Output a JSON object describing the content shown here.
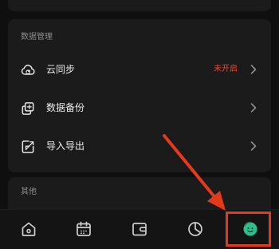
{
  "data_management": {
    "title": "数据管理",
    "items": [
      {
        "label": "云同步",
        "status": "未开启",
        "icon": "cloud-sync-icon"
      },
      {
        "label": "数据备份",
        "status": "",
        "icon": "backup-icon"
      },
      {
        "label": "导入导出",
        "status": "",
        "icon": "import-export-icon"
      }
    ]
  },
  "other": {
    "title": "其他"
  },
  "tabbar": {
    "items": [
      {
        "icon": "home-icon"
      },
      {
        "icon": "calendar-icon"
      },
      {
        "icon": "wallet-icon"
      },
      {
        "icon": "pie-chart-icon"
      },
      {
        "icon": "profile-face-icon",
        "active": true
      }
    ]
  },
  "colors": {
    "background": "#0f0f0f",
    "card": "#1b1b1b",
    "status_red": "#e04b3a",
    "annotation_red": "#e23a1a",
    "active_green": "#2fbf8c"
  }
}
